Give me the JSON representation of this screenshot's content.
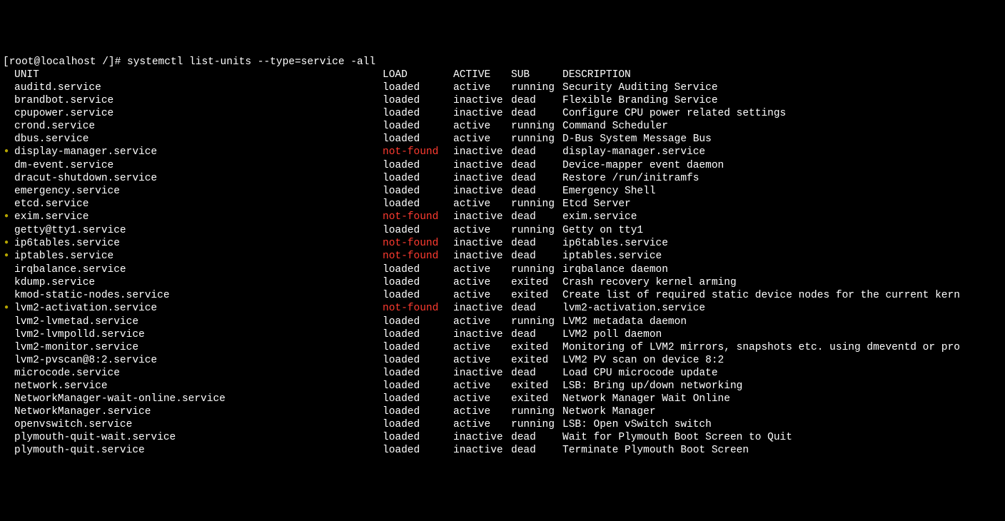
{
  "prompt": "[root@localhost /]# systemctl list-units --type=service -all",
  "headers": {
    "unit": "UNIT",
    "load": "LOAD",
    "active": "ACTIVE",
    "sub": "SUB",
    "description": "DESCRIPTION"
  },
  "rows": [
    {
      "bullet": false,
      "unit": "auditd.service",
      "load": "loaded",
      "active": "active",
      "sub": "running",
      "desc": "Security Auditing Service"
    },
    {
      "bullet": false,
      "unit": "brandbot.service",
      "load": "loaded",
      "active": "inactive",
      "sub": "dead",
      "desc": "Flexible Branding Service"
    },
    {
      "bullet": false,
      "unit": "cpupower.service",
      "load": "loaded",
      "active": "inactive",
      "sub": "dead",
      "desc": "Configure CPU power related settings"
    },
    {
      "bullet": false,
      "unit": "crond.service",
      "load": "loaded",
      "active": "active",
      "sub": "running",
      "desc": "Command Scheduler"
    },
    {
      "bullet": false,
      "unit": "dbus.service",
      "load": "loaded",
      "active": "active",
      "sub": "running",
      "desc": "D-Bus System Message Bus"
    },
    {
      "bullet": true,
      "unit": "display-manager.service",
      "load": "not-found",
      "active": "inactive",
      "sub": "dead",
      "desc": "display-manager.service"
    },
    {
      "bullet": false,
      "unit": "dm-event.service",
      "load": "loaded",
      "active": "inactive",
      "sub": "dead",
      "desc": "Device-mapper event daemon"
    },
    {
      "bullet": false,
      "unit": "dracut-shutdown.service",
      "load": "loaded",
      "active": "inactive",
      "sub": "dead",
      "desc": "Restore /run/initramfs"
    },
    {
      "bullet": false,
      "unit": "emergency.service",
      "load": "loaded",
      "active": "inactive",
      "sub": "dead",
      "desc": "Emergency Shell"
    },
    {
      "bullet": false,
      "unit": "etcd.service",
      "load": "loaded",
      "active": "active",
      "sub": "running",
      "desc": "Etcd Server"
    },
    {
      "bullet": true,
      "unit": "exim.service",
      "load": "not-found",
      "active": "inactive",
      "sub": "dead",
      "desc": "exim.service"
    },
    {
      "bullet": false,
      "unit": "getty@tty1.service",
      "load": "loaded",
      "active": "active",
      "sub": "running",
      "desc": "Getty on tty1"
    },
    {
      "bullet": true,
      "unit": "ip6tables.service",
      "load": "not-found",
      "active": "inactive",
      "sub": "dead",
      "desc": "ip6tables.service"
    },
    {
      "bullet": true,
      "unit": "iptables.service",
      "load": "not-found",
      "active": "inactive",
      "sub": "dead",
      "desc": "iptables.service"
    },
    {
      "bullet": false,
      "unit": "irqbalance.service",
      "load": "loaded",
      "active": "active",
      "sub": "running",
      "desc": "irqbalance daemon"
    },
    {
      "bullet": false,
      "unit": "kdump.service",
      "load": "loaded",
      "active": "active",
      "sub": "exited",
      "desc": "Crash recovery kernel arming"
    },
    {
      "bullet": false,
      "unit": "kmod-static-nodes.service",
      "load": "loaded",
      "active": "active",
      "sub": "exited",
      "desc": "Create list of required static device nodes for the current kern"
    },
    {
      "bullet": true,
      "unit": "lvm2-activation.service",
      "load": "not-found",
      "active": "inactive",
      "sub": "dead",
      "desc": "lvm2-activation.service"
    },
    {
      "bullet": false,
      "unit": "lvm2-lvmetad.service",
      "load": "loaded",
      "active": "active",
      "sub": "running",
      "desc": "LVM2 metadata daemon"
    },
    {
      "bullet": false,
      "unit": "lvm2-lvmpolld.service",
      "load": "loaded",
      "active": "inactive",
      "sub": "dead",
      "desc": "LVM2 poll daemon"
    },
    {
      "bullet": false,
      "unit": "lvm2-monitor.service",
      "load": "loaded",
      "active": "active",
      "sub": "exited",
      "desc": "Monitoring of LVM2 mirrors, snapshots etc. using dmeventd or pro"
    },
    {
      "bullet": false,
      "unit": "lvm2-pvscan@8:2.service",
      "load": "loaded",
      "active": "active",
      "sub": "exited",
      "desc": "LVM2 PV scan on device 8:2"
    },
    {
      "bullet": false,
      "unit": "microcode.service",
      "load": "loaded",
      "active": "inactive",
      "sub": "dead",
      "desc": "Load CPU microcode update"
    },
    {
      "bullet": false,
      "unit": "network.service",
      "load": "loaded",
      "active": "active",
      "sub": "exited",
      "desc": "LSB: Bring up/down networking"
    },
    {
      "bullet": false,
      "unit": "NetworkManager-wait-online.service",
      "load": "loaded",
      "active": "active",
      "sub": "exited",
      "desc": "Network Manager Wait Online"
    },
    {
      "bullet": false,
      "unit": "NetworkManager.service",
      "load": "loaded",
      "active": "active",
      "sub": "running",
      "desc": "Network Manager"
    },
    {
      "bullet": false,
      "unit": "openvswitch.service",
      "load": "loaded",
      "active": "active",
      "sub": "running",
      "desc": "LSB: Open vSwitch switch"
    },
    {
      "bullet": false,
      "unit": "plymouth-quit-wait.service",
      "load": "loaded",
      "active": "inactive",
      "sub": "dead",
      "desc": "Wait for Plymouth Boot Screen to Quit"
    },
    {
      "bullet": false,
      "unit": "plymouth-quit.service",
      "load": "loaded",
      "active": "inactive",
      "sub": "dead",
      "desc": "Terminate Plymouth Boot Screen"
    }
  ]
}
